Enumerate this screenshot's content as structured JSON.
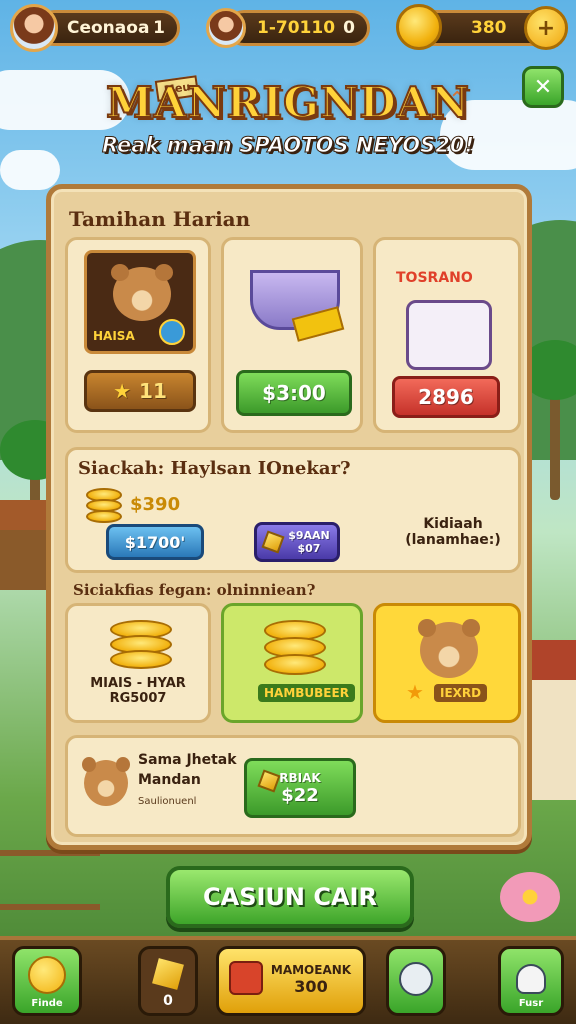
{
  "players": [
    {
      "name": "Ceonaoa",
      "value": "1"
    },
    {
      "name": "1-70110",
      "value": "0"
    }
  ],
  "coins": {
    "value": "380"
  },
  "header": {
    "tag": "Meu",
    "title": "MANRIGNDAN",
    "subtitle": "Reak maan SPAOTOS NEYOS20!"
  },
  "daily": {
    "title": "Tamihan Harian",
    "items": [
      {
        "art_label": "HAISA",
        "button": "11"
      },
      {
        "art_label": "",
        "button": "$3:00"
      },
      {
        "art_label": "TOSRANO",
        "button": "2896"
      }
    ]
  },
  "offer": {
    "title": "Siackah: Haylsan IOnekar?",
    "coin_amount": "$390",
    "buttons": [
      {
        "label": "$1700'"
      },
      {
        "label": "$9AAN\n$07"
      },
      {
        "label": "Kidiaah\n(lanamhae:)"
      }
    ]
  },
  "special": {
    "title": "Siciakfias fegan: olninniean?",
    "items": [
      {
        "label": "MIAIS - HYAR\nRG5007"
      },
      {
        "label": "HAMBUBEER"
      },
      {
        "label": "IEXRD"
      }
    ]
  },
  "bundle": {
    "title_line1": "Sama Jhetak",
    "title_line2": "Mandan",
    "sub": "Saulionuenl",
    "button_top": "RBIAK",
    "button_price": "$22"
  },
  "cta": {
    "label": "CASIUN CAIR"
  },
  "bottom": {
    "btn1": "Finde",
    "btn2": "0",
    "btn3_top": "MAMOEANK",
    "btn3_bottom": "300",
    "btn5": "Fusr"
  }
}
